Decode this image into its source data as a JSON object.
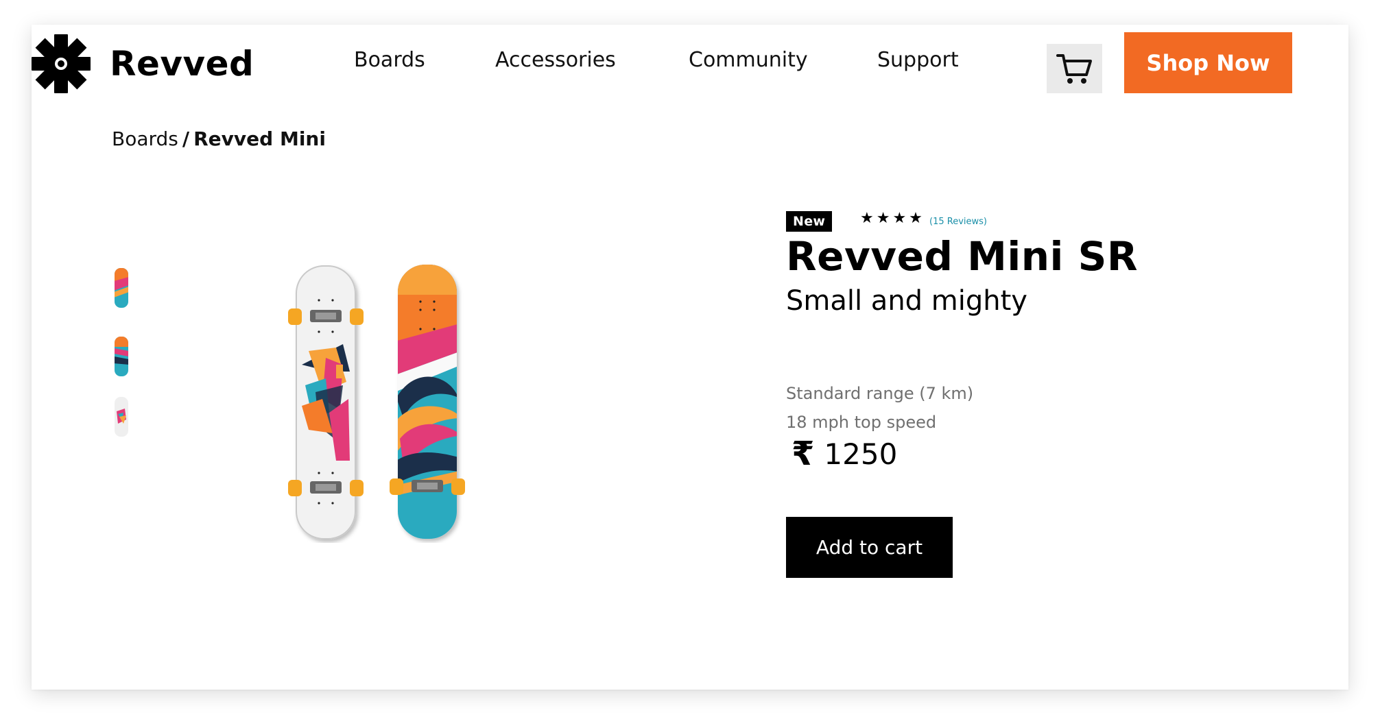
{
  "brand": {
    "name": "Revved",
    "accent": "#f26a23"
  },
  "nav": {
    "items": [
      {
        "label": "Boards"
      },
      {
        "label": "Accessories"
      },
      {
        "label": "Community"
      },
      {
        "label": "Support"
      }
    ],
    "cart_icon": "shopping-cart-icon",
    "cta_label": "Shop Now"
  },
  "breadcrumb": {
    "parent": "Boards",
    "separator": "/",
    "current": "Revved Mini"
  },
  "product": {
    "badge": "New",
    "rating": 4,
    "stars": "★★★★",
    "reviews": "(15 Reviews)",
    "title": "Revved Mini SR",
    "subtitle": "Small and mighty",
    "specs": [
      "Standard range (7 km)",
      "18 mph top speed"
    ],
    "currency_symbol": "₹",
    "price": "1250",
    "add_to_cart_label": "Add to cart",
    "thumbnails": [
      "skateboard-thumb-1",
      "skateboard-thumb-2",
      "skateboard-thumb-3"
    ],
    "images": [
      "skateboard-bottom-white",
      "skateboard-bottom-colorful"
    ]
  }
}
